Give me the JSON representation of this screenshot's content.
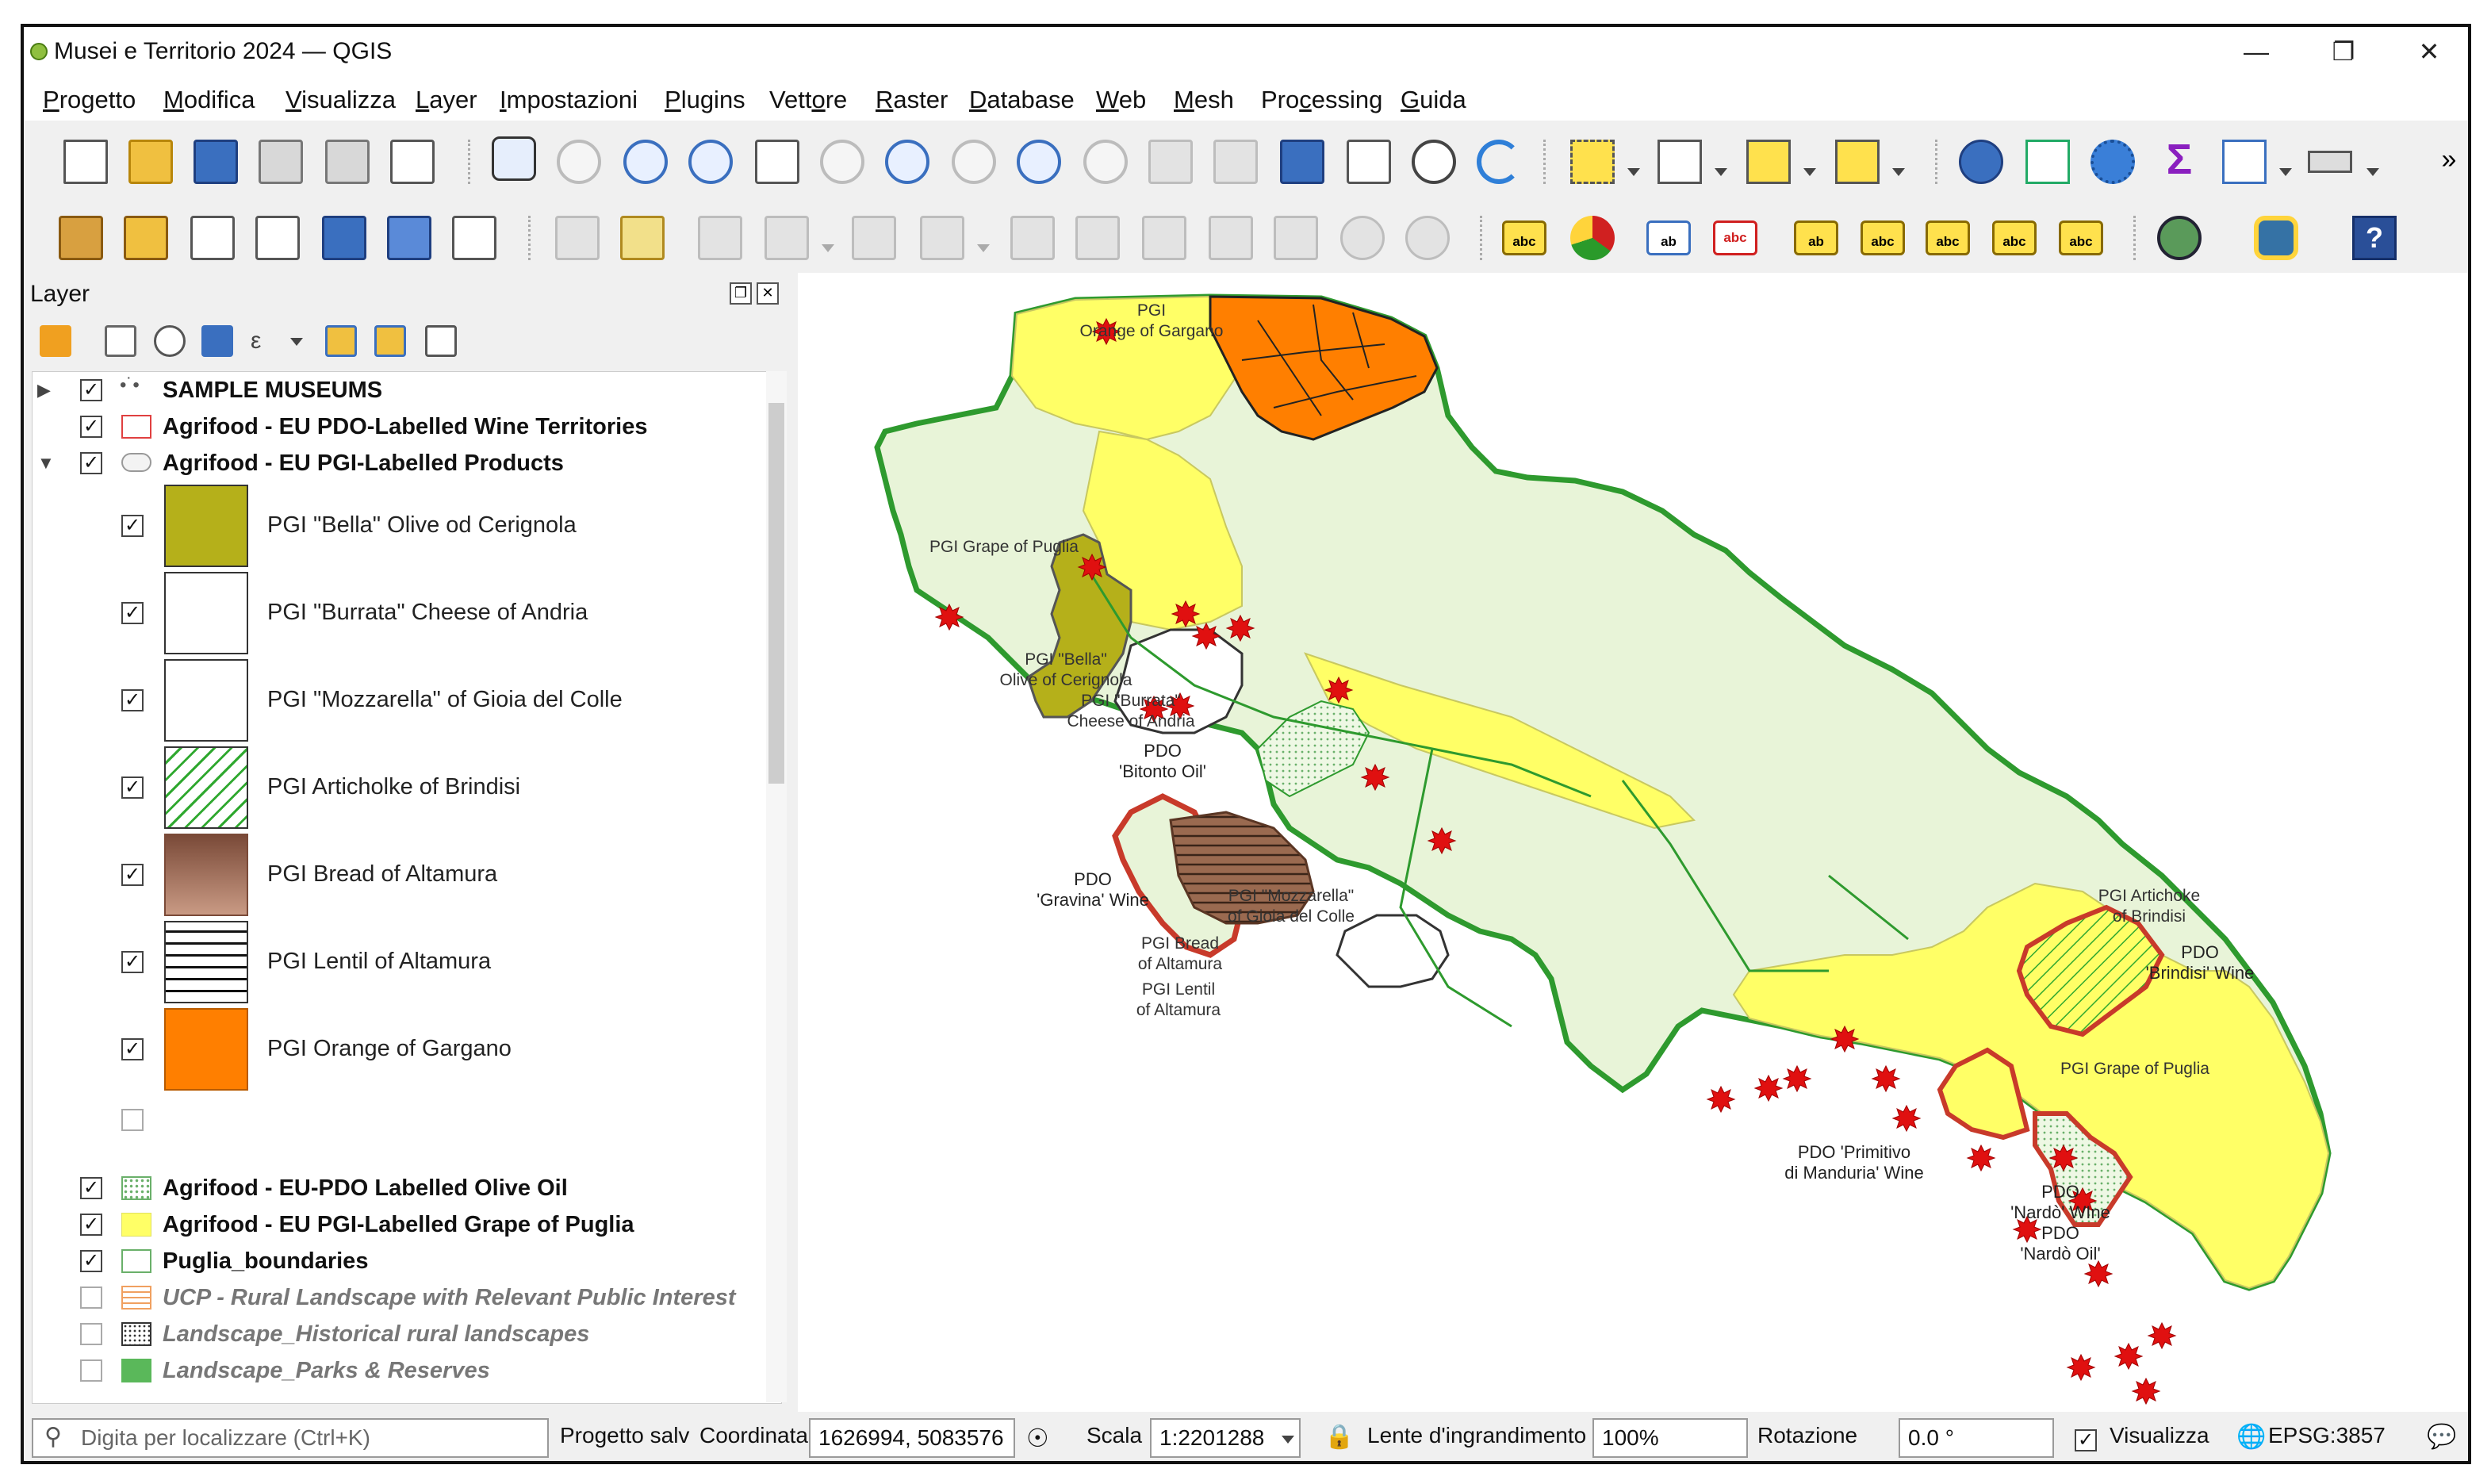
{
  "window": {
    "title": "Musei e Territorio 2024 — QGIS"
  },
  "menubar": {
    "items": [
      {
        "pre": "",
        "ul": "P",
        "post": "rogetto"
      },
      {
        "pre": "",
        "ul": "M",
        "post": "odifica"
      },
      {
        "pre": "",
        "ul": "V",
        "post": "isualizza"
      },
      {
        "pre": "",
        "ul": "L",
        "post": "ayer"
      },
      {
        "pre": "",
        "ul": "I",
        "post": "mpostazioni"
      },
      {
        "pre": "",
        "ul": "P",
        "post": "lugins"
      },
      {
        "pre": "Vett",
        "ul": "o",
        "post": "re"
      },
      {
        "pre": "",
        "ul": "R",
        "post": "aster"
      },
      {
        "pre": "",
        "ul": "D",
        "post": "atabase"
      },
      {
        "pre": "",
        "ul": "W",
        "post": "eb"
      },
      {
        "pre": "",
        "ul": "M",
        "post": "esh"
      },
      {
        "pre": "Pro",
        "ul": "c",
        "post": "essing"
      },
      {
        "pre": "",
        "ul": "G",
        "post": "uida"
      }
    ]
  },
  "toolbar": {
    "more": "»",
    "label_abc": "abc",
    "label_ab": "ab",
    "help": "?"
  },
  "layers_panel": {
    "title": "Layer",
    "layers": [
      {
        "name": "SAMPLE MUSEUMS",
        "checked": true
      },
      {
        "name": "Agrifood - EU PDO-Labelled Wine Territories",
        "checked": true
      },
      {
        "name": "Agrifood - EU PGI-Labelled Products",
        "checked": true
      },
      {
        "name": "Agrifood - EU-PDO Labelled Olive Oil",
        "checked": true
      },
      {
        "name": "Agrifood - EU PGI-Labelled Grape of Puglia",
        "checked": true
      },
      {
        "name": "Puglia_boundaries",
        "checked": true
      },
      {
        "name": "UCP - Rural Landscape with Relevant Public Interest",
        "checked": false
      },
      {
        "name": "Landscape_Historical rural landscapes",
        "checked": false
      },
      {
        "name": "Landscape_Parks & Reserves",
        "checked": false
      }
    ],
    "pgi_classes": [
      {
        "label": "PGI \"Bella\" Olive od Cerignola",
        "color": "#b5b01a"
      },
      {
        "label": "PGI \"Burrata\" Cheese of Andria",
        "color": "#ffffff"
      },
      {
        "label": "PGI \"Mozzarella\" of Gioia del Colle",
        "color": "#ffffff"
      },
      {
        "label": "PGI Articholke of Brindisi",
        "color": "#2fa82f"
      },
      {
        "label": "PGI Bread of Altamura",
        "color": "#8a5a44"
      },
      {
        "label": "PGI Lentil  of Altamura",
        "color": "#111111"
      },
      {
        "label": "PGI Orange of Gargano",
        "color": "#ff7f00"
      }
    ],
    "check": "✓"
  },
  "map": {
    "labels": {
      "orange_1": "PGI",
      "orange_2": "Orange of Gargano",
      "grape_n": "PGI Grape of Puglia",
      "bella_1": "PGI \"Bella\"",
      "bella_2": "Olive of Cerignola",
      "burrata_1": "PGI \"Burrata\"",
      "burrata_2": "Cheese of Andria",
      "bitonto_1": "PDO",
      "bitonto_2": "'Bitonto Oil'",
      "gravina_1": "PDO",
      "gravina_2": "'Gravina' Wine",
      "mozz_1": "PGI \"Mozzarella\"",
      "mozz_2": "of Gioia del Colle",
      "bread_1": "PGI Bread",
      "bread_2": "of Altamura",
      "lentil_1": "PGI Lentil",
      "lentil_2": "of Altamura",
      "artichoke_1": "PGI Artichoke",
      "artichoke_2": "of Brindisi",
      "brindisi_1": "PDO",
      "brindisi_2": "'Brindisi' Wine",
      "grape_s": "PGI Grape of Puglia",
      "primitivo_1": "PDO 'Primitivo",
      "primitivo_2": "di Manduria' Wine",
      "nardo_w_1": "PDO",
      "nardo_w_2": "'Nardò' WIne",
      "nardo_o_1": "PDO",
      "nardo_o_2": "'Nardò Oil'"
    }
  },
  "statusbar": {
    "search_placeholder": "Digita per localizzare (Ctrl+K)",
    "project_saved": "Progetto salv",
    "coord_label": "Coordinata",
    "coord_value": "1626994, 5083576",
    "scale_label": "Scala",
    "scale_value": "1:2201288",
    "magnifier_label": "Lente d'ingrandimento",
    "magnifier_value": "100%",
    "rotation_label": "Rotazione",
    "rotation_value": "0.0 °",
    "render_label": "Visualizza",
    "crs": "EPSG:3857"
  },
  "colors": {
    "grape_yellow": "#ffff66",
    "region_fill": "#e8f4d8",
    "boundary_green": "#2e9a2e",
    "museum_red": "#e01010",
    "orange": "#ff7f00"
  }
}
